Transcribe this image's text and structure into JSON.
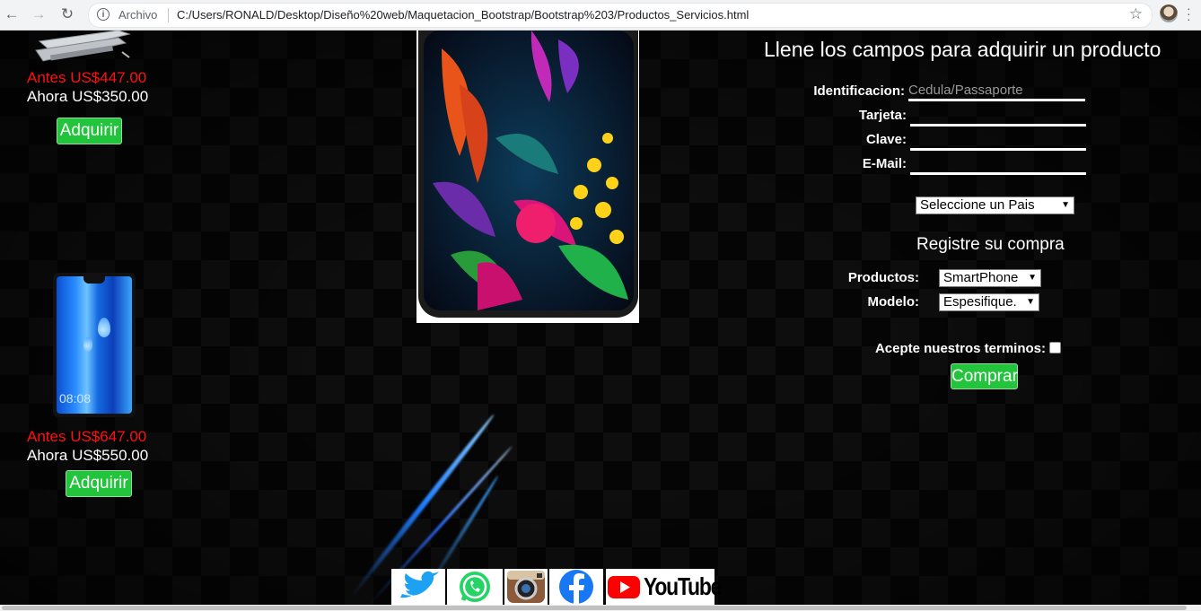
{
  "browser": {
    "back_icon": "arrow-left",
    "forward_icon": "arrow-right",
    "reload_icon": "reload",
    "info_icon": "i",
    "scheme_label": "Archivo",
    "url": "C:/Users/RONALD/Desktop/Diseño%20web/Maquetacion_Bootstrap/Bootstrap%203/Productos_Servicios.html",
    "star_icon": "☆"
  },
  "products": [
    {
      "old_price": "Antes US$447.00",
      "new_price": "Ahora US$350.00",
      "button": "Adquirir"
    },
    {
      "old_price": "Antes US$647.00",
      "new_price": "Ahora US$550.00",
      "button": "Adquirir",
      "phone_time": "08:08"
    }
  ],
  "form": {
    "title": "Llene los campos para adquirir un producto",
    "fields": [
      {
        "label": "Identificacion:",
        "placeholder": "Cedula/Passaporte",
        "value": ""
      },
      {
        "label": "Tarjeta:",
        "placeholder": "",
        "value": ""
      },
      {
        "label": "Clave:",
        "placeholder": "",
        "value": ""
      },
      {
        "label": "E-Mail:",
        "placeholder": "",
        "value": ""
      }
    ],
    "country_select": "Seleccione un Pais",
    "register_title": "Registre su compra",
    "productos_label": "Productos:",
    "productos_value": "SmartPhone",
    "modelo_label": "Modelo:",
    "modelo_value": "Espesifique.",
    "terms_label": "Acepte nuestros terminos:",
    "terms_checked": false,
    "buy_button": "Comprar"
  },
  "social": {
    "youtube_label": "YouTube"
  },
  "colors": {
    "old_price": "#ff1010",
    "button_green": "#21c43a",
    "background": "#050505"
  }
}
